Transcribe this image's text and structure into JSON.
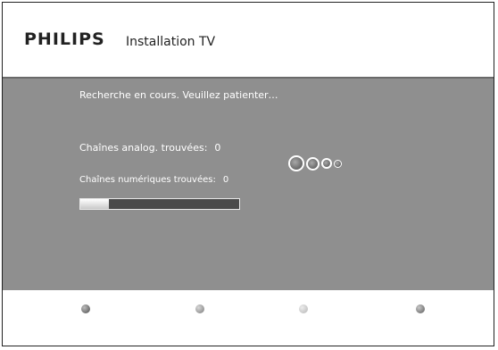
{
  "header": {
    "brand": "PHILIPS",
    "title": "Installation TV"
  },
  "panel": {
    "status": "Recherche en cours. Veuillez patienter…",
    "analog_label": "Chaînes analog. trouvées:",
    "analog_value": "0",
    "digital_label": "Chaînes numériques trouvées:",
    "digital_value": "0",
    "progress_percent": 18
  },
  "footer": {
    "buttons": [
      {
        "icon": "red-button-icon"
      },
      {
        "icon": "green-button-icon"
      },
      {
        "icon": "yellow-button-icon"
      },
      {
        "icon": "blue-button-icon"
      }
    ]
  }
}
